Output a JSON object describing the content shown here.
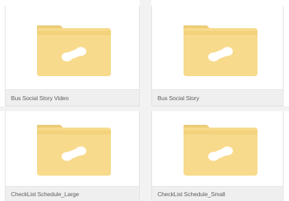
{
  "folders": [
    {
      "name": "Bus Social Story Video",
      "icon": "shared-folder-icon"
    },
    {
      "name": "Bus Social Story",
      "icon": "shared-folder-icon"
    },
    {
      "name": "CheckList Schedule_Large",
      "icon": "shared-folder-icon"
    },
    {
      "name": "CheckList Schedule_Small",
      "icon": "shared-folder-icon"
    }
  ],
  "colors": {
    "folder_body": "#f7da8c",
    "folder_tab": "#eccc77",
    "folder_inner": "#f3d27c",
    "link_glyph": "#ffffff",
    "label_bar": "#efefef",
    "label_text": "#5c5c5c"
  }
}
